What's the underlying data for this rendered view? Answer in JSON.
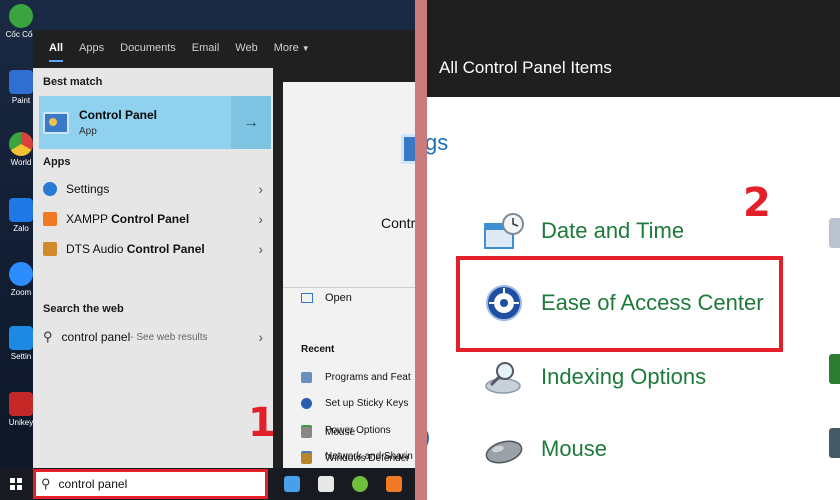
{
  "desktop": {
    "icons": [
      {
        "label": "Cốc Cốc",
        "icon": "coccoc-icon",
        "color": "#3aa43f"
      },
      {
        "label": "Paint",
        "icon": "paint-icon",
        "color": "#2f6fd1"
      },
      {
        "label": "World",
        "icon": "chrome-icon",
        "color": "#d9433a"
      },
      {
        "label": "Zalo",
        "icon": "zalo-icon",
        "color": "#1f78e6"
      },
      {
        "label": "Zoom",
        "icon": "zoom-icon",
        "color": "#2d8cff"
      },
      {
        "label": "Settin",
        "icon": "settings-icon",
        "color": "#1e88e5"
      },
      {
        "label": "Unikey",
        "icon": "unikey-icon",
        "color": "#c62828"
      }
    ]
  },
  "start_menu": {
    "tabs": [
      "All",
      "Apps",
      "Documents",
      "Email",
      "Web",
      "More"
    ],
    "best_match_heading": "Best match",
    "best_match": {
      "title": "Control Panel",
      "subtitle": "App"
    },
    "apps_heading": "Apps",
    "apps": [
      {
        "prefix": "Settings",
        "bold": "",
        "suffix": "",
        "icon": "settings-gear-icon",
        "color": "#2a7ad5"
      },
      {
        "prefix": "XAMPP ",
        "bold": "Control Panel",
        "suffix": "",
        "icon": "xampp-icon",
        "color": "#f07a24"
      },
      {
        "prefix": "DTS Audio ",
        "bold": "Control Panel",
        "suffix": "",
        "icon": "dts-audio-icon",
        "color": "#d08a2a"
      }
    ],
    "web_heading": "Search the web",
    "web_result": {
      "query": "control panel",
      "suffix": " - See web results"
    },
    "preview": {
      "title": "Contr",
      "open_label": "Open",
      "recent_heading": "Recent",
      "recent": [
        {
          "label": "Programs and Feat",
          "color": "#6a8fbf"
        },
        {
          "label": "Set up Sticky Keys",
          "color": "#2a5bb0"
        },
        {
          "label": "Power Options",
          "color": "#3e9a3e"
        },
        {
          "label": "Network and Sharin",
          "color": "#4a7ac0"
        },
        {
          "label": "Mouse",
          "color": "#888888"
        },
        {
          "label": "Windows Defender",
          "color": "#b8862a"
        }
      ]
    }
  },
  "taskbar": {
    "search_value": "control panel"
  },
  "steps": {
    "one": "1",
    "two": "2"
  },
  "control_panel": {
    "title": "All Control Panel Items",
    "cut_text": "gs",
    "cut_paren": ")",
    "items": [
      {
        "label": "Date and Time",
        "icon": "date-time-icon",
        "color": "#3d8fd6"
      },
      {
        "label": "Ease of Access Center",
        "icon": "ease-of-access-icon",
        "color": "#1f4fa3"
      },
      {
        "label": "Indexing Options",
        "icon": "indexing-icon",
        "color": "#8a9aa8"
      },
      {
        "label": "Mouse",
        "icon": "mouse-icon",
        "color": "#6c7278"
      }
    ]
  },
  "colors": {
    "highlight": "#e3202a",
    "link_green": "#1e7a3a",
    "accent": "#5ea7ff"
  }
}
